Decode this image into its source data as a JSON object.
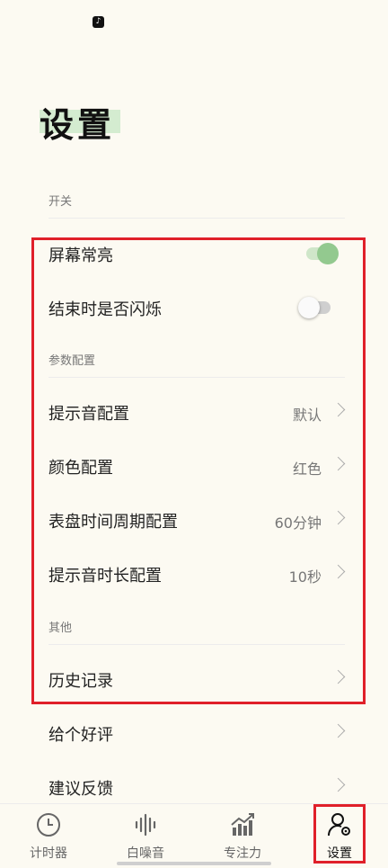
{
  "status_bar": {
    "notification_icon": "tiktok-icon"
  },
  "page": {
    "title": "设置"
  },
  "sections": {
    "switches": {
      "label": "开关"
    },
    "params": {
      "label": "参数配置"
    },
    "other": {
      "label": "其他"
    }
  },
  "rows": {
    "screen_on": {
      "label": "屏幕常亮",
      "toggle": "on"
    },
    "flash_on_end": {
      "label": "结束时是否闪烁",
      "toggle": "off"
    },
    "sound": {
      "label": "提示音配置",
      "value": "默认"
    },
    "color": {
      "label": "颜色配置",
      "value": "红色"
    },
    "dial_period": {
      "label": "表盘时间周期配置",
      "value": "60分钟"
    },
    "sound_duration": {
      "label": "提示音时长配置",
      "value": "10秒"
    },
    "history": {
      "label": "历史记录"
    },
    "rate": {
      "label": "给个好评"
    },
    "feedback": {
      "label": "建议反馈"
    }
  },
  "bottom_nav": {
    "timer": "计时器",
    "white_noise": "白噪音",
    "focus": "专注力",
    "settings": "设置",
    "active": "settings"
  },
  "colors": {
    "background": "#fcfaf2",
    "accent_green": "#93c98f",
    "highlight_red": "#e0202a"
  }
}
